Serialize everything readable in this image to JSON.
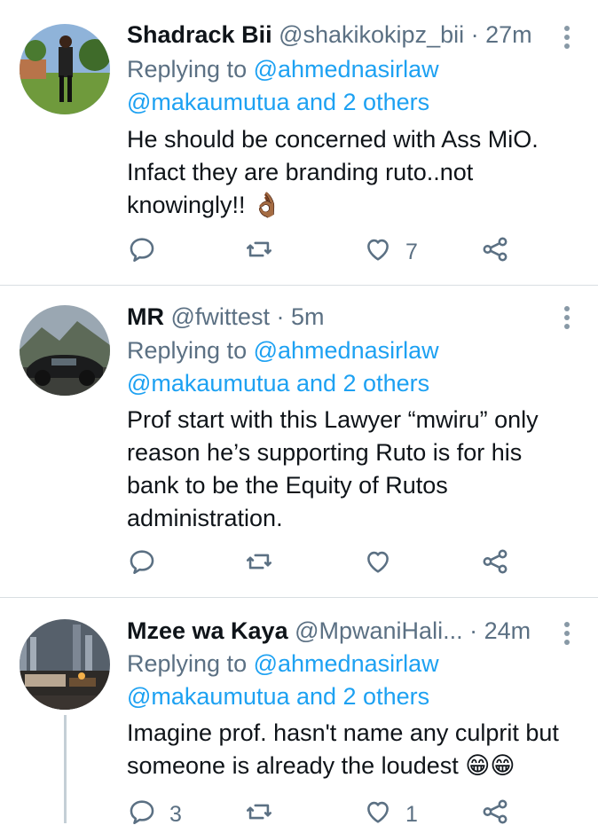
{
  "tweets": [
    {
      "name": "Shadrack Bii",
      "handle": "@shakikokipz_bii",
      "time": "· 27m",
      "reply_prefix": "Replying to",
      "reply_user": "@ahmednasirlaw",
      "reply_more": "@makaumutua and 2 others",
      "lines": [
        "He should be concerned with Ass MiO.",
        "Infact they are branding ruto..not",
        "knowingly!! 👌🏾"
      ],
      "replies": "",
      "retweets": "",
      "likes": "7"
    },
    {
      "name": "MR",
      "handle": "@fwittest",
      "time": "· 5m",
      "reply_prefix": "Replying to",
      "reply_user": "@ahmednasirlaw",
      "reply_more": "@makaumutua and 2 others",
      "lines": [
        "Prof start with this Lawyer “mwiru” only",
        "reason he’s supporting Ruto is for his",
        "bank to be the Equity of Rutos",
        "administration."
      ],
      "replies": "",
      "retweets": "",
      "likes": ""
    },
    {
      "name": "Mzee wa Kaya",
      "handle": "@MpwaniHali...",
      "time": "· 24m",
      "reply_prefix": "Replying to",
      "reply_user": "@ahmednasirlaw",
      "reply_more": "@makaumutua and 2 others",
      "lines": [
        "Imagine prof. hasn't name any culprit but",
        "someone is already the loudest 😁😁"
      ],
      "replies": "3",
      "retweets": "",
      "likes": "1"
    }
  ],
  "icons": {
    "reply": "reply-icon",
    "retweet": "retweet-icon",
    "like": "heart-icon",
    "share": "share-icon",
    "more": "more-vertical-icon"
  },
  "colors": {
    "link": "#1da1f2",
    "muted": "#5b7083",
    "text": "#0f1419",
    "divider": "#d9dee2"
  }
}
